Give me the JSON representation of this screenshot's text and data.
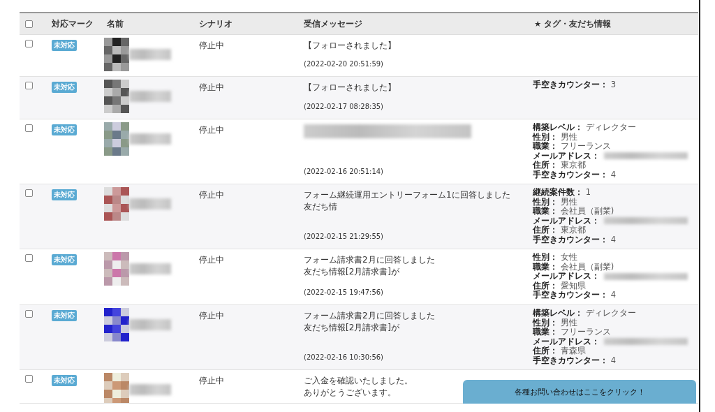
{
  "table": {
    "columns": [
      "対応マーク",
      "名前",
      "シナリオ",
      "受信メッセージ",
      "★ タグ・友だち情報"
    ],
    "header_checked": false,
    "rows": [
      {
        "checked": false,
        "mark": "未対応",
        "scenario": "停止中",
        "message": {
          "kind": "text",
          "lines": [
            "【フォローされました】"
          ]
        },
        "date": "(2022-02-20 20:51:59)",
        "tags": []
      },
      {
        "checked": false,
        "mark": "未対応",
        "scenario": "停止中",
        "message": {
          "kind": "text",
          "lines": [
            "【フォローされました】"
          ]
        },
        "date": "(2022-02-17 08:28:35)",
        "tags": [
          {
            "kind": "text",
            "label": "手空きカウンター：",
            "value": "3"
          }
        ]
      },
      {
        "checked": false,
        "mark": "未対応",
        "scenario": "停止中",
        "message": {
          "kind": "blurred"
        },
        "date": "(2022-02-16 20:51:14)",
        "tags": [
          {
            "kind": "text",
            "label": "構築レベル：",
            "value": "ディレクター"
          },
          {
            "kind": "text",
            "label": "性別：",
            "value": "男性"
          },
          {
            "kind": "text",
            "label": "職業：",
            "value": "フリーランス"
          },
          {
            "kind": "blurred",
            "label": "メールアドレス："
          },
          {
            "kind": "text",
            "label": "住所：",
            "value": "東京都"
          },
          {
            "kind": "text",
            "label": "手空きカウンター：",
            "value": "4"
          }
        ]
      },
      {
        "checked": false,
        "mark": "未対応",
        "scenario": "停止中",
        "message": {
          "kind": "text",
          "lines": [
            "フォーム継続運用エントリーフォーム1に回答しました",
            "友だち情"
          ]
        },
        "date": "(2022-02-15 21:29:55)",
        "tags": [
          {
            "kind": "text",
            "label": "継続案件数：",
            "value": "1"
          },
          {
            "kind": "text",
            "label": "性別：",
            "value": "男性"
          },
          {
            "kind": "text",
            "label": "職業：",
            "value": "会社員（副業)"
          },
          {
            "kind": "blurred",
            "label": "メールアドレス："
          },
          {
            "kind": "text",
            "label": "住所：",
            "value": "東京都"
          },
          {
            "kind": "text",
            "label": "手空きカウンター：",
            "value": "4"
          }
        ]
      },
      {
        "checked": false,
        "mark": "未対応",
        "scenario": "停止中",
        "message": {
          "kind": "text",
          "lines": [
            "フォーム請求書2月に回答しました",
            "友だち情報[2月請求書]が"
          ]
        },
        "date": "(2022-02-15 19:47:56)",
        "tags": [
          {
            "kind": "text",
            "label": "性別：",
            "value": "女性"
          },
          {
            "kind": "text",
            "label": "職業：",
            "value": "会社員（副業)"
          },
          {
            "kind": "blurred",
            "label": "メールアドレス："
          },
          {
            "kind": "text",
            "label": "住所：",
            "value": "愛知県"
          },
          {
            "kind": "text",
            "label": "手空きカウンター：",
            "value": "4"
          }
        ]
      },
      {
        "checked": false,
        "mark": "未対応",
        "scenario": "停止中",
        "message": {
          "kind": "text",
          "lines": [
            "フォーム請求書2月に回答しました",
            "友だち情報[2月請求書]が"
          ]
        },
        "date": "(2022-02-16 10:30:56)",
        "tags": [
          {
            "kind": "text",
            "label": "構築レベル：",
            "value": "ディレクター"
          },
          {
            "kind": "text",
            "label": "性別：",
            "value": "男性"
          },
          {
            "kind": "text",
            "label": "職業：",
            "value": "フリーランス"
          },
          {
            "kind": "blurred",
            "label": "メールアドレス："
          },
          {
            "kind": "text",
            "label": "住所：",
            "value": "青森県"
          },
          {
            "kind": "text",
            "label": "手空きカウンター：",
            "value": "4"
          }
        ]
      },
      {
        "checked": false,
        "mark": "未対応",
        "scenario": "停止中",
        "message": {
          "kind": "text",
          "lines": [
            "ご入金を確認いたしました。",
            "ありがとうございます。"
          ]
        },
        "tags": []
      }
    ]
  },
  "contact_button": "各種お問い合わせはここをクリック！"
}
